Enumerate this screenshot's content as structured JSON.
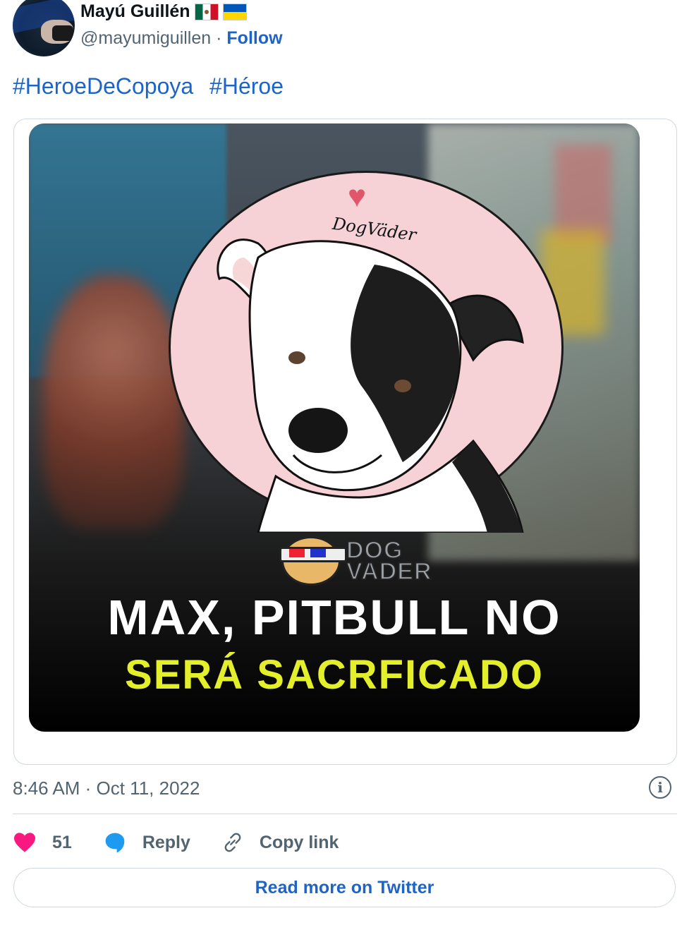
{
  "author": {
    "display_name": "Mayú Guillén",
    "handle": "@mayumiguillen",
    "separator": "·",
    "follow_label": "Follow",
    "flags": [
      "mexico-flag",
      "ukraine-flag"
    ]
  },
  "tweet": {
    "hashtags": [
      "#HeroeDeCopoya",
      "#Héroe"
    ],
    "image": {
      "signature": "DogVäder",
      "logo_line1": "DOG",
      "logo_line2": "VADER",
      "headline": "MAX, PITBULL NO",
      "subhead": "SERÁ SACRFICADO"
    },
    "timestamp": "8:46 AM · Oct 11, 2022"
  },
  "actions": {
    "likes": "51",
    "reply_label": "Reply",
    "copy_label": "Copy link",
    "read_more_label": "Read more on Twitter"
  },
  "colors": {
    "link": "#1d64c8",
    "like_heart": "#f91880",
    "reply_icon": "#1d9bf0",
    "subhead": "#e4ef2b"
  }
}
